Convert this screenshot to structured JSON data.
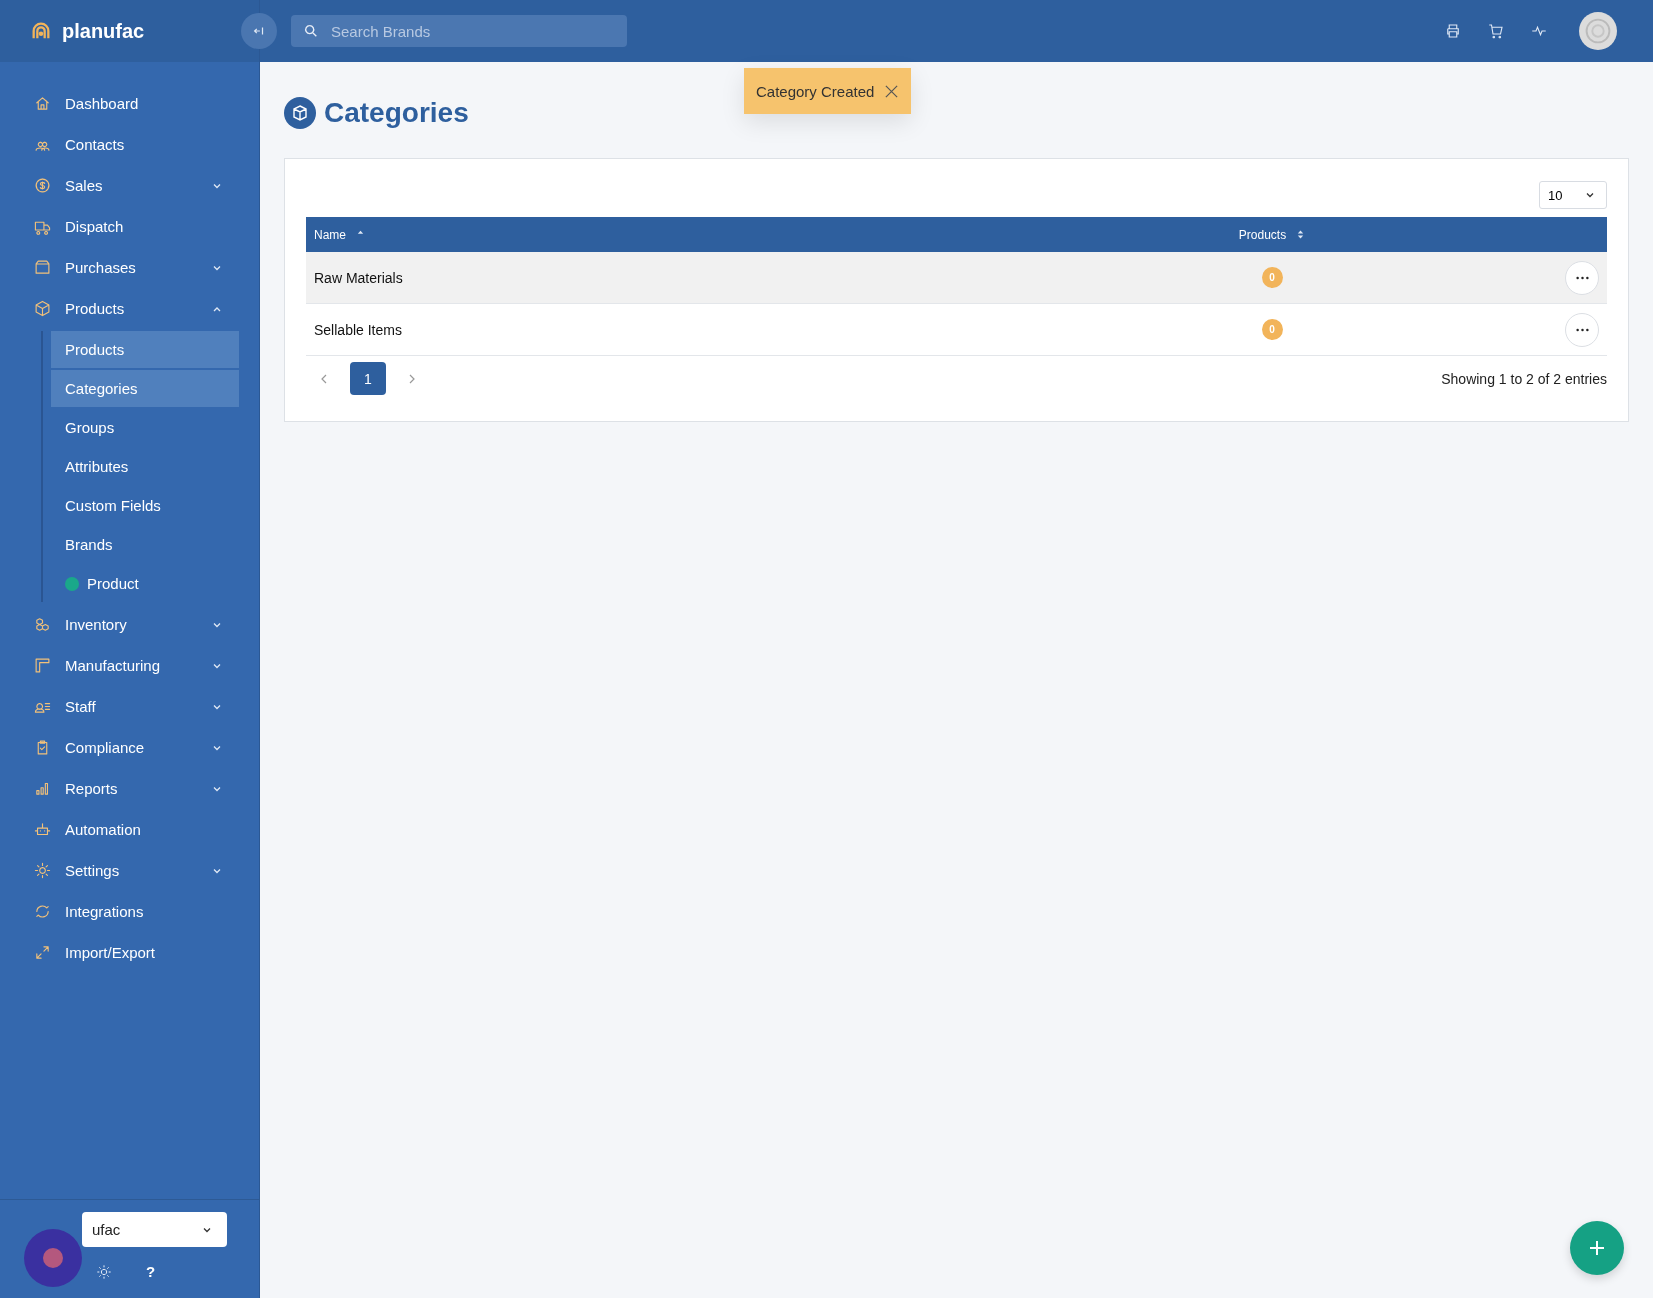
{
  "brand": {
    "name": "planufac"
  },
  "search": {
    "placeholder": "Search Brands"
  },
  "sidebar": {
    "items": [
      {
        "label": "Dashboard",
        "kind": "link"
      },
      {
        "label": "Contacts",
        "kind": "link"
      },
      {
        "label": "Sales",
        "kind": "group",
        "expanded": false
      },
      {
        "label": "Dispatch",
        "kind": "link"
      },
      {
        "label": "Purchases",
        "kind": "group",
        "expanded": false
      },
      {
        "label": "Products",
        "kind": "group",
        "expanded": true,
        "children": [
          {
            "label": "Products",
            "selected": true
          },
          {
            "label": "Categories",
            "selected": true
          },
          {
            "label": "Groups",
            "selected": false
          },
          {
            "label": "Attributes",
            "selected": false
          },
          {
            "label": "Custom Fields",
            "selected": false
          },
          {
            "label": "Brands",
            "selected": false
          },
          {
            "label": "Product",
            "selected": false,
            "color": "#1aa88a"
          }
        ]
      },
      {
        "label": "Inventory",
        "kind": "group",
        "expanded": false
      },
      {
        "label": "Manufacturing",
        "kind": "group",
        "expanded": false
      },
      {
        "label": "Staff",
        "kind": "group",
        "expanded": false
      },
      {
        "label": "Compliance",
        "kind": "group",
        "expanded": false
      },
      {
        "label": "Reports",
        "kind": "group",
        "expanded": false
      },
      {
        "label": "Automation",
        "kind": "link"
      },
      {
        "label": "Settings",
        "kind": "group",
        "expanded": false
      },
      {
        "label": "Integrations",
        "kind": "link"
      },
      {
        "label": "Import/Export",
        "kind": "link"
      }
    ],
    "workspace": "ufac",
    "footer_buttons": [
      "?"
    ]
  },
  "page": {
    "title": "Categories"
  },
  "toast": {
    "message": "Category Created"
  },
  "table": {
    "page_size": "10",
    "columns": [
      {
        "label": "Name",
        "sorted": true
      },
      {
        "label": "Products",
        "sorted": false
      }
    ],
    "rows": [
      {
        "name": "Raw Materials",
        "products": "0",
        "hovered": true
      },
      {
        "name": "Sellable Items",
        "products": "0",
        "hovered": false
      }
    ],
    "pages": [
      {
        "label": "1",
        "selected": true
      }
    ],
    "info": "Showing 1 to 2 of 2 entries"
  }
}
